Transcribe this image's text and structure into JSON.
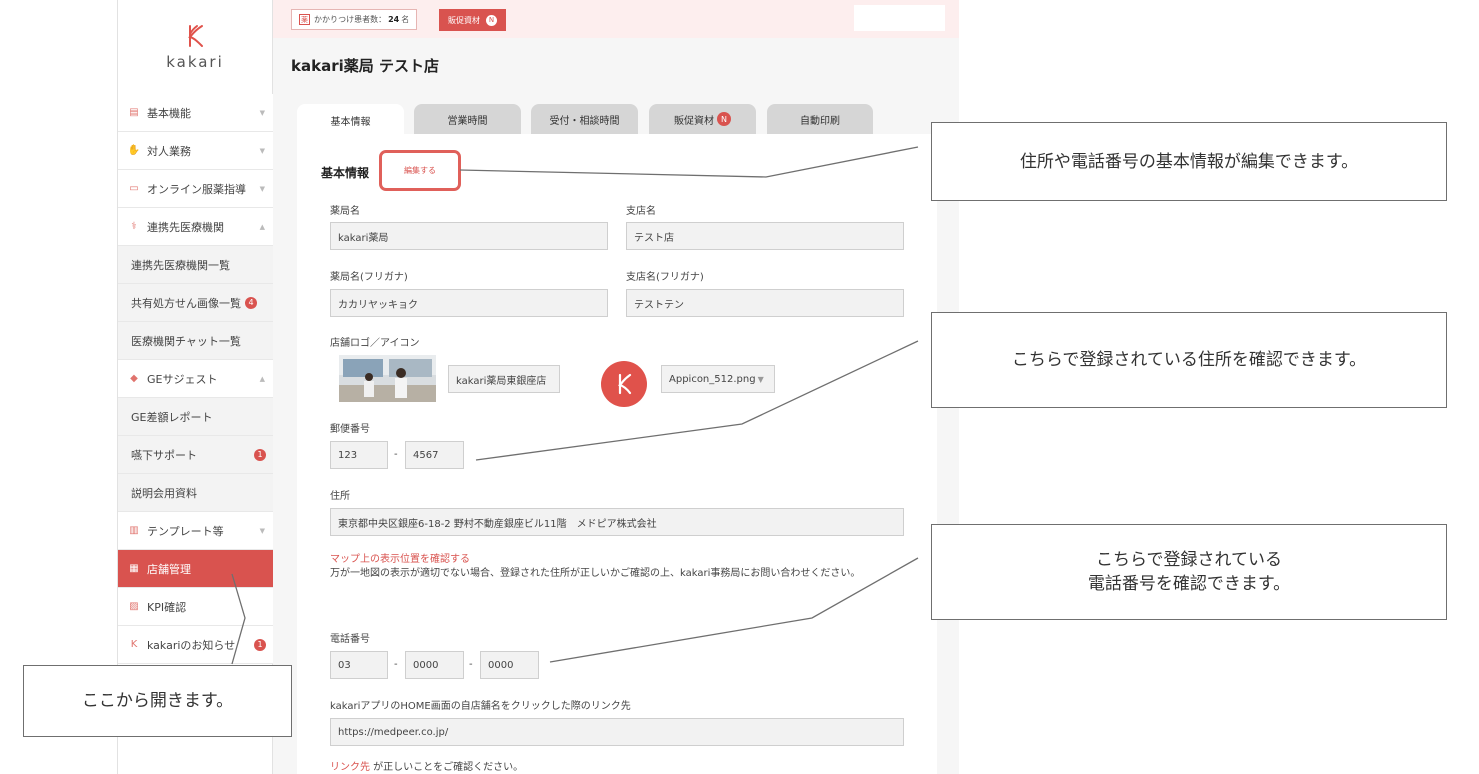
{
  "logo": {
    "text": "kakari"
  },
  "sidebar": {
    "items": [
      {
        "label": "基本機能",
        "icon": "document-icon",
        "type": "main",
        "caret": "▼"
      },
      {
        "label": "対人業務",
        "icon": "hands-icon",
        "type": "main",
        "caret": "▼"
      },
      {
        "label": "オンライン服薬指導",
        "icon": "video-icon",
        "type": "main",
        "caret": "▼"
      },
      {
        "label": "連携先医療機関",
        "icon": "stethoscope-icon",
        "type": "main",
        "caret": "▲"
      },
      {
        "label": "連携先医療機関一覧",
        "type": "sub"
      },
      {
        "label": "共有処方せん画像一覧",
        "type": "sub",
        "badge": "4"
      },
      {
        "label": "医療機関チャット一覧",
        "type": "sub"
      },
      {
        "label": "GEサジェスト",
        "icon": "pill-icon",
        "type": "main",
        "caret": "▲"
      },
      {
        "label": "GE差額レポート",
        "type": "sub"
      },
      {
        "label": "嚥下サポート",
        "type": "sub",
        "badge": "1"
      },
      {
        "label": "説明会用資料",
        "type": "sub"
      },
      {
        "label": "テンプレート等",
        "icon": "template-icon",
        "type": "main",
        "caret": "▼"
      },
      {
        "label": "店舗管理",
        "icon": "store-icon",
        "type": "main",
        "active": true
      },
      {
        "label": "KPI確認",
        "icon": "chart-icon",
        "type": "main"
      },
      {
        "label": "kakariのお知らせ",
        "icon": "kakari-icon",
        "type": "main",
        "badge": "1"
      }
    ]
  },
  "topbar": {
    "patients_label": "かかりつけ患者数：",
    "patients_count": "24",
    "patients_unit": "名",
    "promo_label": "販促資材",
    "promo_badge": "N"
  },
  "page_title": "kakari薬局 テスト店",
  "tabs": [
    {
      "label": "基本情報",
      "active": true
    },
    {
      "label": "営業時間"
    },
    {
      "label": "受付・相談時間"
    },
    {
      "label": "販促資材",
      "badge": "N"
    },
    {
      "label": "自動印刷"
    }
  ],
  "form": {
    "section_title": "基本情報",
    "edit_button": "編集する",
    "pharmacy_name_label": "薬局名",
    "pharmacy_name": "kakari薬局",
    "branch_name_label": "支店名",
    "branch_name": "テスト店",
    "pharmacy_kana_label": "薬局名(フリガナ)",
    "pharmacy_kana": "カカリヤッキョク",
    "branch_kana_label": "支店名(フリガナ)",
    "branch_kana": "テストテン",
    "logo_label": "店舗ロゴ／アイコン",
    "logo_file": "kakari薬局東銀座店",
    "icon_file": "Appicon_512.png",
    "postal_label": "郵便番号",
    "postal_1": "123",
    "postal_2": "4567",
    "address_label": "住所",
    "address": "東京都中央区銀座6-18-2 野村不動産銀座ビル11階　メドピア株式会社",
    "map_link": "マップ上の表示位置を確認する",
    "map_note": "万が一地図の表示が適切でない場合、登録された住所が正しいかご確認の上、kakari事務局にお問い合わせください。",
    "phone_label": "電話番号",
    "phone_1": "03",
    "phone_2": "0000",
    "phone_3": "0000",
    "link_label": "kakariアプリのHOME画面の自店舗名をクリックした際のリンク先",
    "link_url": "https://medpeer.co.jp/",
    "link_note_link": "リンク先",
    "link_note": " が正しいことをご確認ください。",
    "dash": "-"
  },
  "callouts": {
    "edit": "住所や電話番号の基本情報が編集できます。",
    "address": "こちらで登録されている住所を確認できます。",
    "phone_line1": "こちらで登録されている",
    "phone_line2": "電話番号を確認できます。",
    "open": "ここから開きます。"
  },
  "colors": {
    "accent": "#d9534f",
    "topbar": "#fdeeee",
    "sidebar_sub": "#f3f3f3"
  }
}
